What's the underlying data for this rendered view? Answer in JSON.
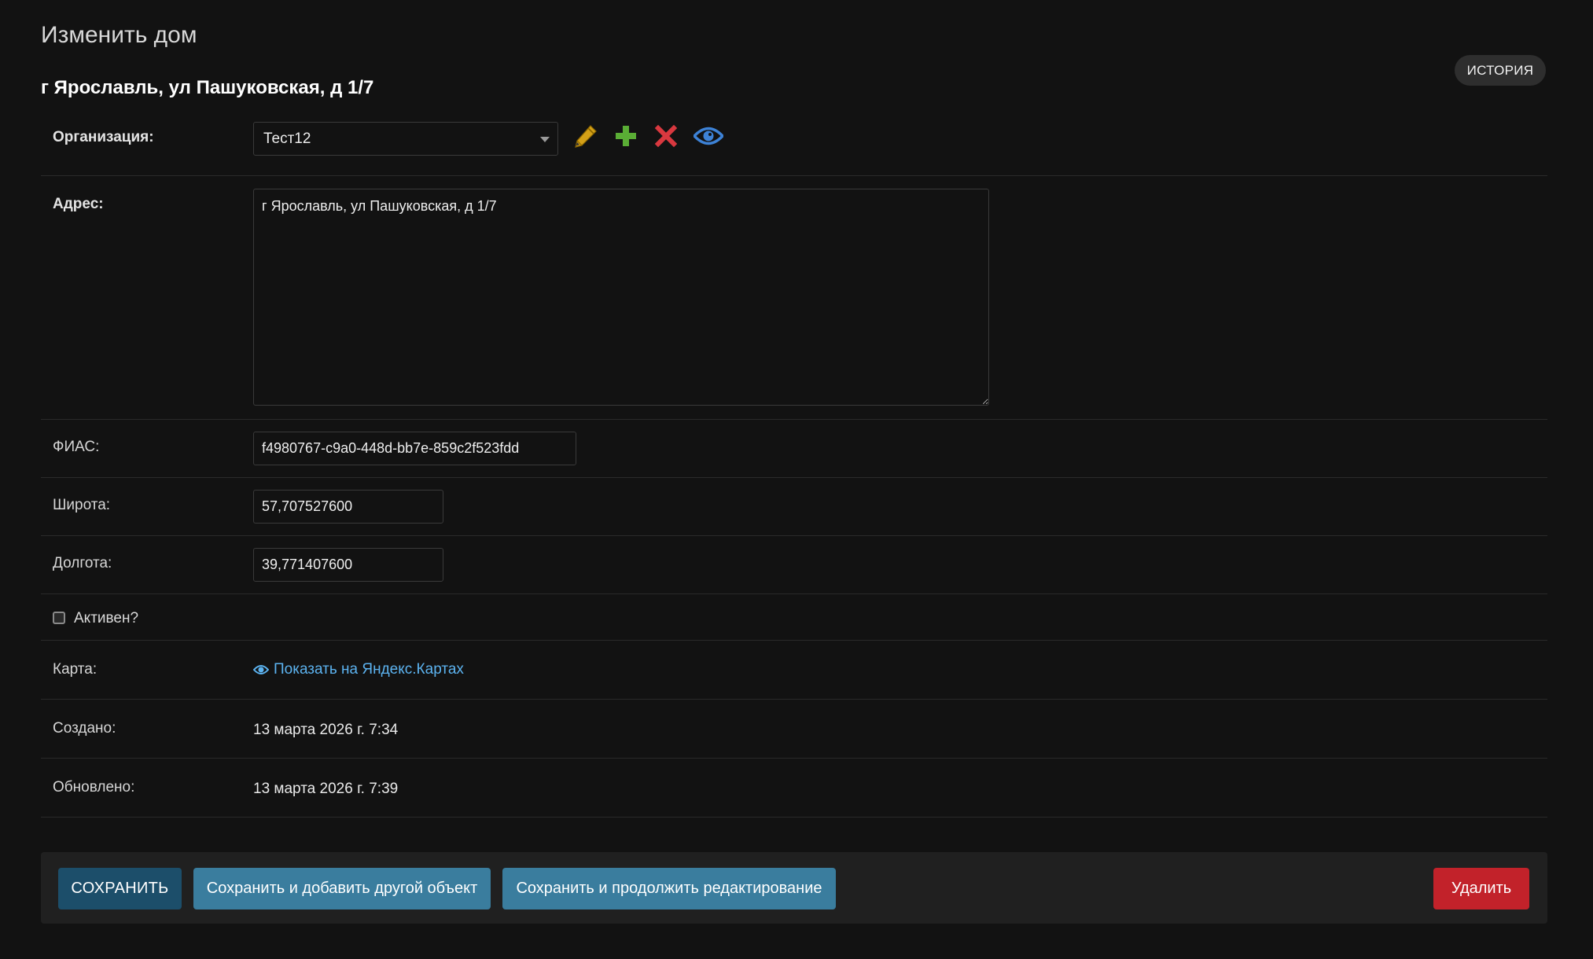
{
  "page": {
    "title": "Изменить дом",
    "history_label": "ИСТОРИЯ",
    "object_title": "г Ярославль, ул Пашуковская, д 1/7"
  },
  "fields": {
    "organization": {
      "label": "Организация:",
      "value": "Тест12",
      "actions": [
        "edit-icon",
        "add-icon",
        "delete-icon",
        "view-icon"
      ]
    },
    "address": {
      "label": "Адрес:",
      "value": "г Ярославль, ул Пашуковская, д 1/7"
    },
    "fias": {
      "label": "ФИАС:",
      "value": "f4980767-c9a0-448d-bb7e-859c2f523fdd"
    },
    "latitude": {
      "label": "Широта:",
      "value": "57,707527600"
    },
    "longitude": {
      "label": "Долгота:",
      "value": "39,771407600"
    },
    "active": {
      "label": "Активен?",
      "checked": false
    },
    "map": {
      "label": "Карта:",
      "link_text": "Показать на Яндекс.Картах",
      "icon": "eye-icon"
    },
    "created": {
      "label": "Создано:",
      "value": "13 марта 2026 г. 7:34"
    },
    "updated": {
      "label": "Обновлено:",
      "value": "13 марта 2026 г. 7:39"
    }
  },
  "actions": {
    "save": "СОХРАНИТЬ",
    "save_add_another": "Сохранить и добавить другой объект",
    "save_continue": "Сохранить и продолжить редактирование",
    "delete": "Удалить"
  },
  "colors": {
    "background": "#121212",
    "primary": "#1c4e6a",
    "secondary": "#3a7d9e",
    "danger": "#c2222a",
    "link": "#5cb3f0",
    "edit_icon": "#d4a017",
    "add_icon": "#5aad35",
    "delete_icon": "#d9383f",
    "view_icon": "#3d82d6"
  }
}
